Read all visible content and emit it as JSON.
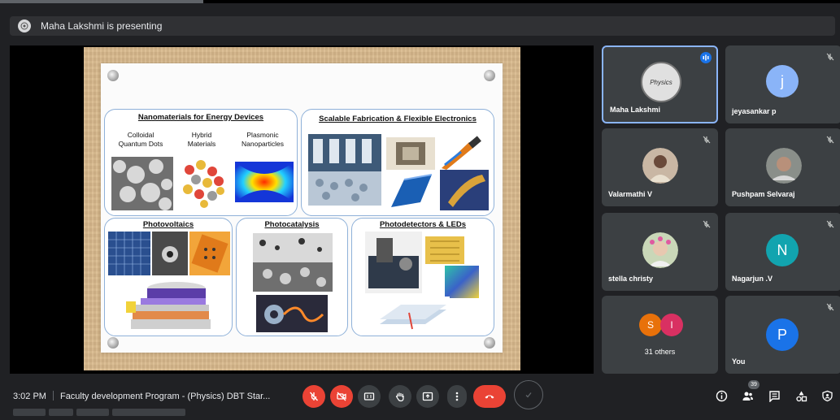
{
  "presenting_banner": {
    "text": "Maha Lakshmi is presenting"
  },
  "slide": {
    "panels": [
      {
        "title": "Nanomaterials for Energy Devices",
        "captions": [
          "Colloidal\nQuantum Dots",
          "Hybrid\nMaterials",
          "Plasmonic\nNanoparticles"
        ]
      },
      {
        "title": "Scalable Fabrication & Flexible Electronics"
      },
      {
        "title": "Photovoltaics"
      },
      {
        "title": "Photocatalysis"
      },
      {
        "title": "Photodetectors & LEDs"
      }
    ],
    "small_labels": {
      "physics_logo": "Physics"
    }
  },
  "participants": [
    {
      "name": "Maha Lakshmi",
      "initial": "",
      "type": "logo",
      "speaking": true,
      "muted": false
    },
    {
      "name": "jeyasankar p",
      "initial": "j",
      "type": "letter",
      "color": "#8ab4f8",
      "muted": true
    },
    {
      "name": "Valarmathi V",
      "initial": "",
      "type": "photo",
      "muted": true
    },
    {
      "name": "Pushpam Selvaraj",
      "initial": "",
      "type": "photo",
      "muted": true
    },
    {
      "name": "stella christy",
      "initial": "",
      "type": "photo",
      "muted": true
    },
    {
      "name": "Nagarjun .V",
      "initial": "N",
      "type": "letter",
      "color": "#12a4af",
      "muted": true
    },
    {
      "name": "31 others",
      "initials": [
        "S",
        "I"
      ],
      "colors": [
        "#e8710a",
        "#d93062"
      ],
      "type": "group"
    },
    {
      "name": "You",
      "initial": "P",
      "type": "letter",
      "color": "#1a73e8",
      "muted": true
    }
  ],
  "bottom_bar": {
    "time": "3:02 PM",
    "meeting_title": "Faculty development Program - (Physics) DBT Star...",
    "participant_count": "39",
    "icons": [
      "mic-off-icon",
      "camera-off-icon",
      "captions-icon",
      "raise-hand-icon",
      "present-icon",
      "more-options-icon",
      "end-call-icon",
      "info-icon",
      "people-icon",
      "chat-icon",
      "activities-icon",
      "host-controls-icon"
    ]
  },
  "colors": {
    "danger": "#ea4335",
    "accent": "#8ab4f8",
    "tile": "#3c4043",
    "background": "#202124"
  }
}
